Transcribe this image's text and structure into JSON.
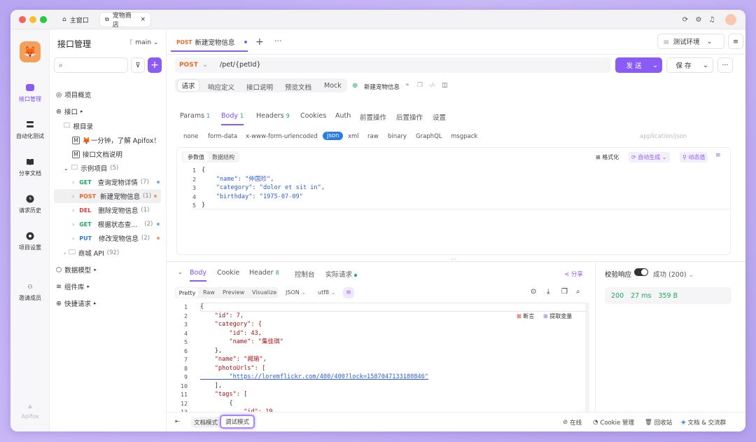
{
  "titlebar": {
    "home_tab": "主窗口",
    "store_tab": "宠物商店"
  },
  "rail": {
    "items": [
      "接口管理",
      "自动化测试",
      "分享文档",
      "请求历史",
      "项目设置",
      "邀请成员"
    ],
    "brand": "Apifox"
  },
  "sidebar": {
    "title": "接口管理",
    "branch": "main",
    "search_placeholder": "",
    "overview": "项目概览",
    "api_root": "接口",
    "root_dir": "根目录",
    "doc1": "🦊一分钟，了解 Apifox！",
    "doc2": "接口文档说明",
    "example": "示例项目",
    "example_count": "(5)",
    "apis": [
      {
        "method": "GET",
        "name": "查询宠物详情",
        "count": "(7)"
      },
      {
        "method": "POST",
        "name": "新建宠物信息",
        "count": "(1)"
      },
      {
        "method": "DEL",
        "name": "删除宠物信息",
        "count": "(1)"
      },
      {
        "method": "GET",
        "name": "根据状态查...",
        "count": "(2)"
      },
      {
        "method": "PUT",
        "name": "修改宠物信息",
        "count": "(2)"
      }
    ],
    "mall": "商城 API",
    "mall_count": "(92)",
    "models": "数据模型",
    "components": "组件库",
    "quick": "快捷请求"
  },
  "doc_tab": {
    "method": "POST",
    "name": "新建宠物信息"
  },
  "env": {
    "label": "测试环境"
  },
  "request": {
    "method": "POST",
    "url": "/pet/{petId}",
    "send": "发 送",
    "save": "保 存"
  },
  "mode_tabs": [
    "请求",
    "响应定义",
    "接口说明",
    "预览文档",
    "Mock"
  ],
  "api_name": "新建宠物信息",
  "param_tabs": [
    {
      "label": "Params",
      "count": "1"
    },
    {
      "label": "Body",
      "count": "1"
    },
    {
      "label": "Headers",
      "count": "9"
    },
    {
      "label": "Cookies",
      "count": ""
    },
    {
      "label": "Auth",
      "count": ""
    },
    {
      "label": "前置操作",
      "count": ""
    },
    {
      "label": "后置操作",
      "count": ""
    },
    {
      "label": "设置",
      "count": ""
    }
  ],
  "body_types": [
    "none",
    "form-data",
    "x-www-form-urlencoded",
    "json",
    "xml",
    "raw",
    "binary",
    "GraphQL",
    "msgpack"
  ],
  "content_type": "application/json",
  "editor_tabs": {
    "a": "参数值",
    "b": "数据结构"
  },
  "editor_actions": {
    "format": "格式化",
    "autogen": "自动生成",
    "dynamic": "动态值"
  },
  "request_body_lines": [
    [
      "1",
      "{"
    ],
    [
      "2",
      "    \"name\": \"仲国珍\","
    ],
    [
      "3",
      "    \"category\": \"dolor et sit in\","
    ],
    [
      "4",
      "    \"birthday\": \"1975-07-09\""
    ],
    [
      "5",
      "}"
    ]
  ],
  "response_tabs": [
    {
      "label": "Body",
      "count": ""
    },
    {
      "label": "Cookie",
      "count": ""
    },
    {
      "label": "Header",
      "count": "8"
    },
    {
      "label": "控制台",
      "count": ""
    },
    {
      "label": "实际请求",
      "count": ""
    }
  ],
  "share": "分享",
  "view_modes": [
    "Pretty",
    "Raw",
    "Preview",
    "Visualize"
  ],
  "format": "JSON",
  "encoding": "utf8",
  "assert_label": "断言",
  "extract_label": "提取变量",
  "response_lines": [
    [
      "1",
      "{"
    ],
    [
      "2",
      "    \"id\": 7,"
    ],
    [
      "3",
      "    \"category\": {"
    ],
    [
      "4",
      "        \"id\": 43,"
    ],
    [
      "5",
      "        \"name\": \"集佳琪\""
    ],
    [
      "6",
      "    },"
    ],
    [
      "7",
      "    \"name\": \"阙瑜\","
    ],
    [
      "8",
      "    \"photoUrls\": ["
    ],
    [
      "9",
      "        \"https://loremflickr.com/400/400?lock=1587047133180846\""
    ],
    [
      "10",
      "    ],"
    ],
    [
      "11",
      "    \"tags\": ["
    ],
    [
      "12",
      "        {"
    ],
    [
      "13",
      "            \"id\": 19,"
    ]
  ],
  "validate": {
    "label": "校验响应",
    "result": "成功 (200)"
  },
  "stats": {
    "status": "200",
    "time": "27 ms",
    "size": "359 B"
  },
  "footer": {
    "doc_mode": "文档模式",
    "debug_mode": "调试模式",
    "online": "在线",
    "cookie": "Cookie 管理",
    "trash": "回收站",
    "docs": "文档 & 交流群"
  },
  "colors": {
    "accent": "#8a5cf5",
    "post": "#f06a1a",
    "get": "#1aa860",
    "del": "#e03a3a",
    "put": "#2a7de1"
  }
}
